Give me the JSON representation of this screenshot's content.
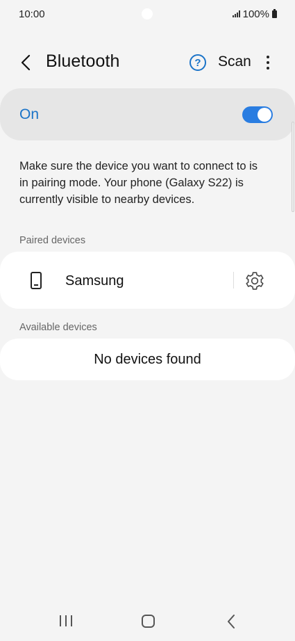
{
  "status_bar": {
    "time": "10:00",
    "battery": "100%",
    "icons": [
      "signal-icon",
      "battery-icon"
    ]
  },
  "header": {
    "title": "Bluetooth",
    "scan_label": "Scan",
    "help_glyph": "?",
    "icons": [
      "back-icon",
      "help-icon",
      "more-options-icon"
    ]
  },
  "master_toggle": {
    "label": "On",
    "enabled": true,
    "accent_color": "#1a73c8"
  },
  "description": "Make sure the device you want to connect to is in pairing mode. Your phone (Galaxy S22) is currently visible to nearby devices.",
  "paired": {
    "section_label": "Paired devices",
    "devices": [
      {
        "name": "Samsung",
        "icon": "smartphone-icon",
        "action_icon": "settings-gear-icon"
      }
    ]
  },
  "available": {
    "section_label": "Available devices",
    "empty_text": "No devices found"
  },
  "nav_bar": {
    "icons": [
      "recent-apps-icon",
      "home-icon",
      "back-nav-icon"
    ]
  }
}
